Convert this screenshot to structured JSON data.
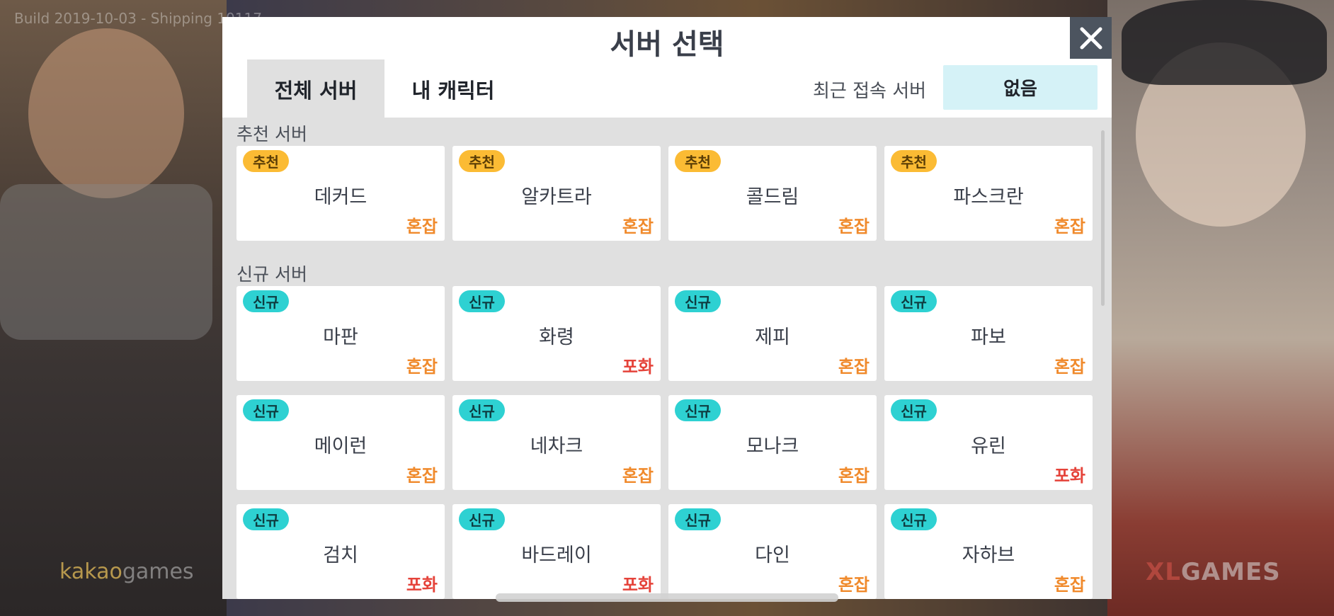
{
  "background": {
    "build_text": "Build 2019-10-03 - Shipping 10117",
    "logo_left_a": "kakao",
    "logo_left_b": "games",
    "logo_right_a": "XL",
    "logo_right_b": "GAMES"
  },
  "modal": {
    "title": "서버 선택",
    "close_icon": "close-icon",
    "tabs": [
      {
        "label": "전체 서버",
        "active": true
      },
      {
        "label": "내 캐릭터",
        "active": false
      }
    ],
    "recent_label": "최근 접속 서버",
    "recent_value": "없음"
  },
  "sections": [
    {
      "title": "추천 서버",
      "rows": [
        [
          {
            "badge": "추천",
            "name": "데커드",
            "status": "혼잡",
            "status_type": "busy"
          },
          {
            "badge": "추천",
            "name": "알카트라",
            "status": "혼잡",
            "status_type": "busy"
          },
          {
            "badge": "추천",
            "name": "콜드림",
            "status": "혼잡",
            "status_type": "busy"
          },
          {
            "badge": "추천",
            "name": "파스크란",
            "status": "혼잡",
            "status_type": "busy"
          }
        ]
      ]
    },
    {
      "title": "신규 서버",
      "rows": [
        [
          {
            "badge": "신규",
            "name": "마판",
            "status": "혼잡",
            "status_type": "busy"
          },
          {
            "badge": "신규",
            "name": "화령",
            "status": "포화",
            "status_type": "full"
          },
          {
            "badge": "신규",
            "name": "제피",
            "status": "혼잡",
            "status_type": "busy"
          },
          {
            "badge": "신규",
            "name": "파보",
            "status": "혼잡",
            "status_type": "busy"
          }
        ],
        [
          {
            "badge": "신규",
            "name": "메이런",
            "status": "혼잡",
            "status_type": "busy"
          },
          {
            "badge": "신규",
            "name": "네차크",
            "status": "혼잡",
            "status_type": "busy"
          },
          {
            "badge": "신규",
            "name": "모나크",
            "status": "혼잡",
            "status_type": "busy"
          },
          {
            "badge": "신규",
            "name": "유린",
            "status": "포화",
            "status_type": "full"
          }
        ],
        [
          {
            "badge": "신규",
            "name": "검치",
            "status": "포화",
            "status_type": "full"
          },
          {
            "badge": "신규",
            "name": "바드레이",
            "status": "포화",
            "status_type": "full"
          },
          {
            "badge": "신규",
            "name": "다인",
            "status": "혼잡",
            "status_type": "busy"
          },
          {
            "badge": "신규",
            "name": "자하브",
            "status": "혼잡",
            "status_type": "busy"
          }
        ]
      ]
    }
  ],
  "colors": {
    "badge_recommended": "#fbbb34",
    "badge_new": "#2ed1d2",
    "status_busy": "#f08a2c",
    "status_full": "#e5433a",
    "recent_bg": "#d5f2f7"
  }
}
